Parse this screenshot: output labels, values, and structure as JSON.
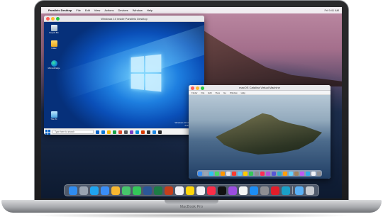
{
  "device": {
    "label": "MacBook Pro"
  },
  "mac_menubar": {
    "apple": "",
    "app_name": "Parallels Desktop",
    "menus": [
      "File",
      "Edit",
      "View",
      "Actions",
      "Devices",
      "Window",
      "Help"
    ],
    "status": "Fri 9:41 AM"
  },
  "windows_vm": {
    "title": "Windows 10 inside Parallels Desktop",
    "desktop_icons": [
      {
        "label": "Recycle Bin",
        "icon": "recycle-bin-icon"
      },
      {
        "label": "Folder",
        "icon": "folder-icon"
      },
      {
        "label": "Microsoft Edge",
        "icon": "edge-icon"
      },
      {
        "label": "This PC",
        "icon": "this-pc-icon"
      }
    ],
    "activate_text_1": "Windows 10 Home Parallels",
    "activate_text_2": "Activate Windows",
    "search_placeholder": "Type here to search",
    "clock_time": "9:41 AM",
    "clock_date": "1/1/2021",
    "taskbar_apps": [
      "#0a64c8",
      "#0b78d8",
      "#f5b800",
      "#1aa34a",
      "#e04a2a",
      "#5a5a5a",
      "#7c3fc8",
      "#0a8fd8",
      "#d83b01",
      "#333333",
      "#1e88e5",
      "#2a2a2a"
    ]
  },
  "mac_vm": {
    "title": "macOS Catalina Virtual Machine",
    "menus": [
      "Finder",
      "File",
      "Edit",
      "View",
      "Go",
      "Window",
      "Help"
    ],
    "dock_colors": [
      "#3a8ef6",
      "#9aa4b2",
      "#2ec4f0",
      "#4cd964",
      "#ff9500",
      "#e5e5ea",
      "#ff3b30",
      "#5ac8fa",
      "#ffcc00",
      "#34c759",
      "#8e8e93",
      "#ff2d55",
      "#af52de",
      "#5856d6",
      "#30b0c7",
      "#ff9f0a",
      "#64d2ff",
      "#a2845e",
      "#bf5af2",
      "#32ade6",
      "#f2f2f7",
      "#8e8e93"
    ]
  },
  "dock": {
    "apps": [
      {
        "name": "finder",
        "color": "#2f8cf0"
      },
      {
        "name": "launchpad",
        "color": "#9aa4b2"
      },
      {
        "name": "safari",
        "color": "#1fa5f0"
      },
      {
        "name": "mail",
        "color": "#3a8ef6"
      },
      {
        "name": "photos",
        "color": "#f7b731"
      },
      {
        "name": "maps",
        "color": "#47c66b"
      },
      {
        "name": "messages",
        "color": "#34c759"
      },
      {
        "name": "word",
        "color": "#2b5797"
      },
      {
        "name": "excel",
        "color": "#1d7c45"
      },
      {
        "name": "powerpoint",
        "color": "#c43e1c"
      },
      {
        "name": "calendar",
        "color": "#f2f2f7"
      },
      {
        "name": "notes",
        "color": "#ffd60a"
      },
      {
        "name": "reminders",
        "color": "#f2f2f7"
      },
      {
        "name": "music",
        "color": "#fa2d48"
      },
      {
        "name": "tv",
        "color": "#111111"
      },
      {
        "name": "podcasts",
        "color": "#9b4de0"
      },
      {
        "name": "news",
        "color": "#f5f5f5"
      },
      {
        "name": "app-store",
        "color": "#1c8df5"
      },
      {
        "name": "system-preferences",
        "color": "#8e8e93"
      },
      {
        "name": "parallels",
        "color": "#e11d2a"
      },
      {
        "name": "edge",
        "color": "#1aa0c8"
      }
    ],
    "trailing": [
      {
        "name": "downloads",
        "color": "#5ab0f5"
      },
      {
        "name": "trash",
        "color": "#c9ccd1"
      }
    ]
  }
}
